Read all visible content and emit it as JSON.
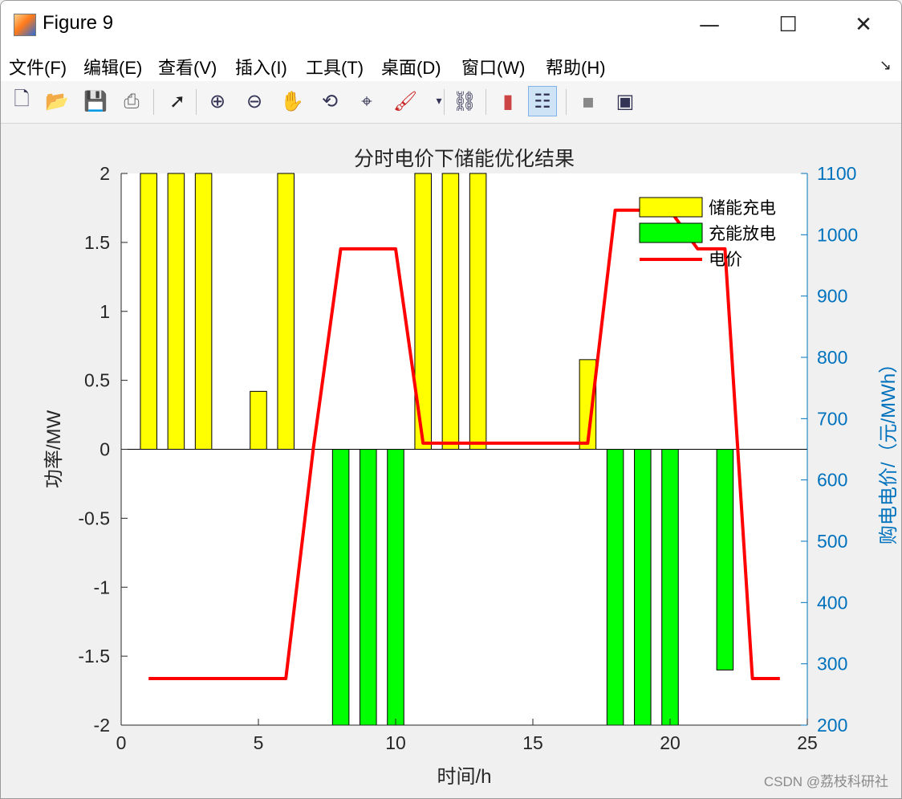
{
  "window": {
    "title": "Figure 9",
    "minimize": "—",
    "maximize": "☐",
    "close": "✕"
  },
  "menu": {
    "items": [
      "文件(F)",
      "编辑(E)",
      "查看(V)",
      "插入(I)",
      "工具(T)",
      "桌面(D)",
      "窗口(W)",
      "帮助(H)"
    ],
    "overflow": "↘"
  },
  "toolbar": {
    "icons": [
      "new-figure-icon",
      "open-file-icon",
      "save-icon",
      "print-icon",
      "select-arrow-icon",
      "zoom-in-icon",
      "zoom-out-icon",
      "pan-hand-icon",
      "rotate-3d-icon",
      "data-cursor-icon",
      "brush-icon",
      "link-plot-icon",
      "colorbar-icon",
      "legend-icon",
      "hide-plot-tools-icon",
      "show-plot-tools-icon"
    ]
  },
  "watermark": "CSDN @荔枝科研社",
  "chart_data": {
    "type": "bar",
    "title": "分时电价下储能优化结果",
    "xlabel": "时间/h",
    "ylabel": "功率/MW",
    "ylabel_right": "购电电价/（元/MWh）",
    "xlim": [
      0,
      25
    ],
    "ylim": [
      -2,
      2
    ],
    "ylim_right": [
      200,
      1100
    ],
    "xticks": [
      0,
      5,
      10,
      15,
      20,
      25
    ],
    "yticks": [
      -2,
      -1.5,
      -1,
      -0.5,
      0,
      0.5,
      1,
      1.5,
      2
    ],
    "yticks_right": [
      200,
      300,
      400,
      500,
      600,
      700,
      800,
      900,
      1000,
      1100
    ],
    "legend_position": "top-right",
    "colors": {
      "charge": "#ffff00",
      "discharge": "#00ff00",
      "price": "#ff0000",
      "right_axis": "#0072bd"
    },
    "hours": [
      1,
      2,
      3,
      4,
      5,
      6,
      7,
      8,
      9,
      10,
      11,
      12,
      13,
      14,
      15,
      16,
      17,
      18,
      19,
      20,
      21,
      22,
      23,
      24
    ],
    "series": [
      {
        "name": "储能充电",
        "kind": "bar",
        "axis": "left",
        "values": [
          2,
          2,
          2,
          0,
          0.42,
          2,
          0,
          0,
          0,
          0,
          2,
          2,
          2,
          0,
          0,
          0,
          0.65,
          0,
          0,
          0,
          0,
          0,
          0,
          0
        ]
      },
      {
        "name": "充能放电",
        "kind": "bar",
        "axis": "left",
        "values": [
          0,
          0,
          0,
          0,
          0,
          0,
          0,
          -2,
          -2,
          -2,
          0,
          0,
          0,
          0,
          0,
          0,
          0,
          -2,
          -2,
          -2,
          0,
          -1.6,
          0,
          0
        ]
      },
      {
        "name": "电价",
        "kind": "line",
        "axis": "right",
        "values": [
          276,
          276,
          276,
          276,
          276,
          276,
          651,
          977,
          977,
          977,
          660,
          660,
          660,
          660,
          660,
          660,
          660,
          1040,
          1040,
          1040,
          977,
          977,
          276,
          276
        ]
      }
    ]
  }
}
